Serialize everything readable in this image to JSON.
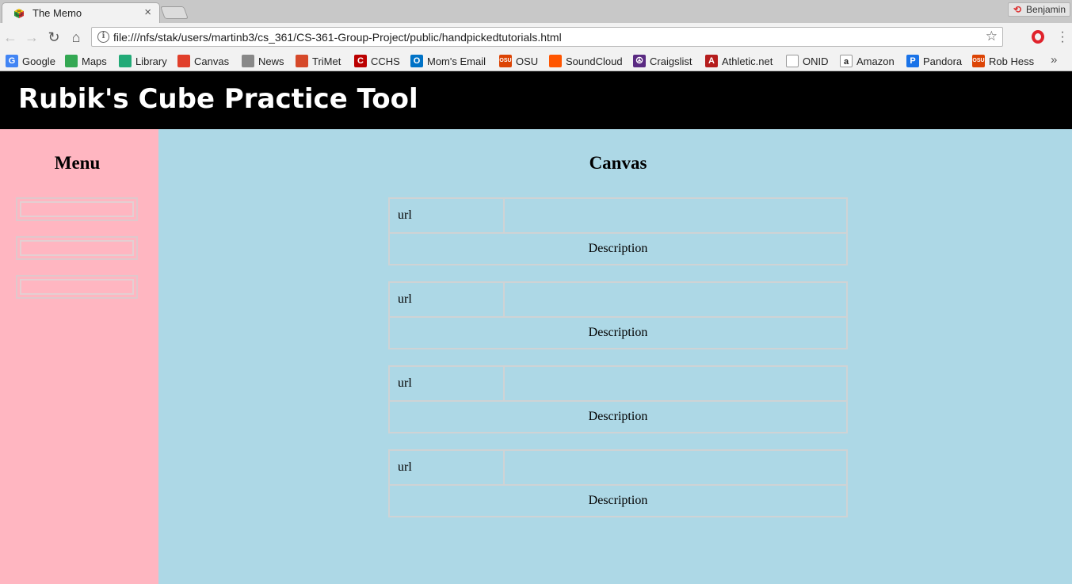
{
  "browser": {
    "tab_title": "The Memo",
    "tab_close": "×",
    "profile_name": "Benjamin",
    "url": "file:///nfs/stak/users/martinb3/cs_361/CS-361-Group-Project/public/handpickedtutorials.html",
    "bookmarks": [
      {
        "label": "Google",
        "icon": "google-icon",
        "color": "#4285f4",
        "glyph": "G"
      },
      {
        "label": "Maps",
        "icon": "maps-icon",
        "color": "#34a853",
        "glyph": ""
      },
      {
        "label": "Library",
        "icon": "library-icon",
        "color": "#2a7",
        "glyph": ""
      },
      {
        "label": "Canvas",
        "icon": "canvas-icon",
        "color": "#e13f2b",
        "glyph": ""
      },
      {
        "label": "News",
        "icon": "news-icon",
        "color": "#888",
        "glyph": ""
      },
      {
        "label": "TriMet",
        "icon": "trimet-icon",
        "color": "#d6492a",
        "glyph": ""
      },
      {
        "label": "CCHS",
        "icon": "cchs-icon",
        "color": "#b00",
        "glyph": "C"
      },
      {
        "label": "Mom's Email",
        "icon": "outlook-icon",
        "color": "#0072c6",
        "glyph": "O"
      },
      {
        "label": "OSU",
        "icon": "osu-icon",
        "color": "#dc4405",
        "glyph": "OSU"
      },
      {
        "label": "SoundCloud",
        "icon": "soundcloud-icon",
        "color": "#ff5500",
        "glyph": ""
      },
      {
        "label": "Craigslist",
        "icon": "craigslist-icon",
        "color": "#5a2a82",
        "glyph": "☮"
      },
      {
        "label": "Athletic.net",
        "icon": "athletic-net-icon",
        "color": "#b51d1d",
        "glyph": "A"
      },
      {
        "label": "ONID",
        "icon": "page-icon",
        "color": "#ffffff",
        "glyph": ""
      },
      {
        "label": "Amazon",
        "icon": "amazon-icon",
        "color": "#ffffff",
        "glyph": "a"
      },
      {
        "label": "Pandora",
        "icon": "pandora-icon",
        "color": "#1a73e8",
        "glyph": "P"
      },
      {
        "label": "Rob Hess",
        "icon": "osu-coe-icon",
        "color": "#dc4405",
        "glyph": "OSU"
      }
    ],
    "more_bookmarks": "»"
  },
  "page": {
    "site_title": "Rubik's Cube Practice Tool",
    "menu_title": "Menu",
    "canvas_title": "Canvas",
    "menu_items": [
      "",
      "",
      ""
    ],
    "cards": [
      {
        "url_label": "url",
        "description": "Description"
      },
      {
        "url_label": "url",
        "description": "Description"
      },
      {
        "url_label": "url",
        "description": "Description"
      },
      {
        "url_label": "url",
        "description": "Description"
      }
    ]
  },
  "colors": {
    "header_bg": "#000000",
    "sidebar_bg": "#ffb6c1",
    "main_bg": "#add8e6"
  }
}
